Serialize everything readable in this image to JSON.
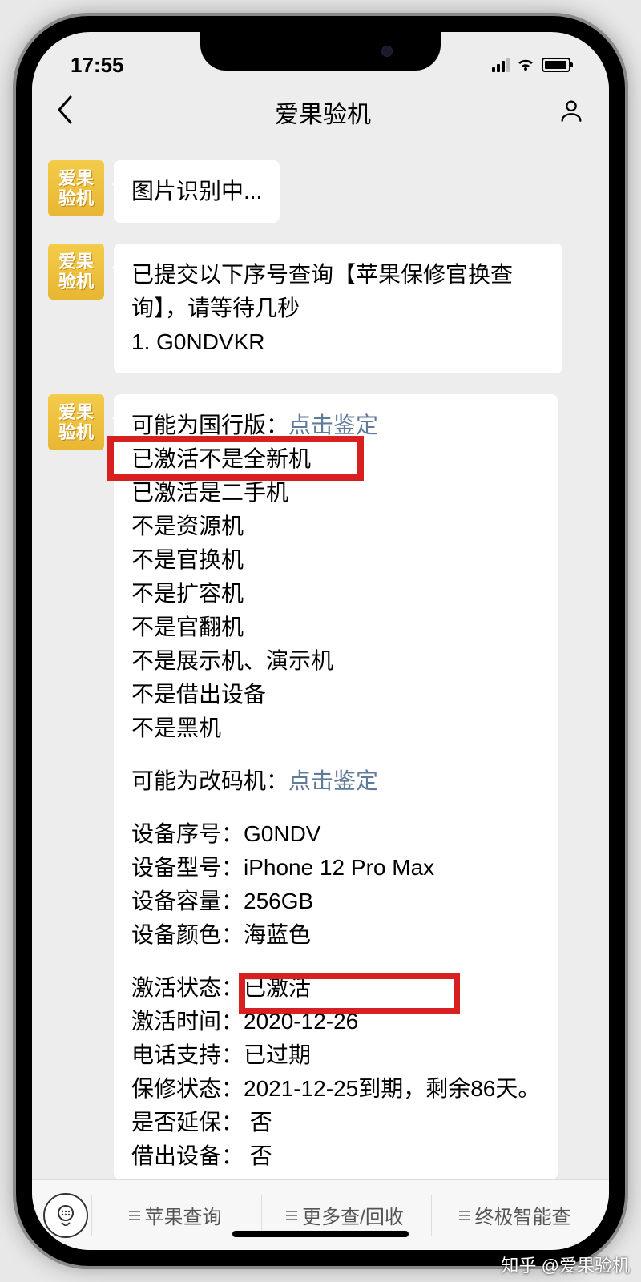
{
  "status": {
    "time": "17:55"
  },
  "nav": {
    "title": "爱果验机"
  },
  "avatar_label": "爱果\n验机",
  "msg1": {
    "text": "图片识别中..."
  },
  "msg2": {
    "line1": "已提交以下序号查询【苹果保修官换查询】，请等待几秒",
    "line2": "1. G0NDVKR"
  },
  "msg3": {
    "l01a": "可能为国行版：",
    "l01_link": "点击鉴定",
    "l02": "已激活不是全新机",
    "l03": "已激活是二手机",
    "l04": "不是资源机",
    "l05": "不是官换机",
    "l06": "不是扩容机",
    "l07": "不是官翻机",
    "l08": "不是展示机、演示机",
    "l09": "不是借出设备",
    "l10": "不是黑机",
    "l11a": "可能为改码机：",
    "l11_link": "点击鉴定",
    "l12": "设备序号：G0NDV",
    "l13": "设备型号：iPhone 12 Pro Max",
    "l14": "设备容量：256GB",
    "l15": "设备颜色：海蓝色",
    "l16": "激活状态：已激活",
    "l17a": "激活时间：",
    "l17b": "2020-12-26",
    "l18": "电话支持：已过期",
    "l19": "保修状态：2021-12-25到期，剩余86天。",
    "l20": "是否延保： 否",
    "l21": "借出设备： 否"
  },
  "bottom": {
    "tab1": "苹果查询",
    "tab2": "更多查/回收",
    "tab3": "终极智能查"
  },
  "watermark": "知乎 @爱果验机"
}
